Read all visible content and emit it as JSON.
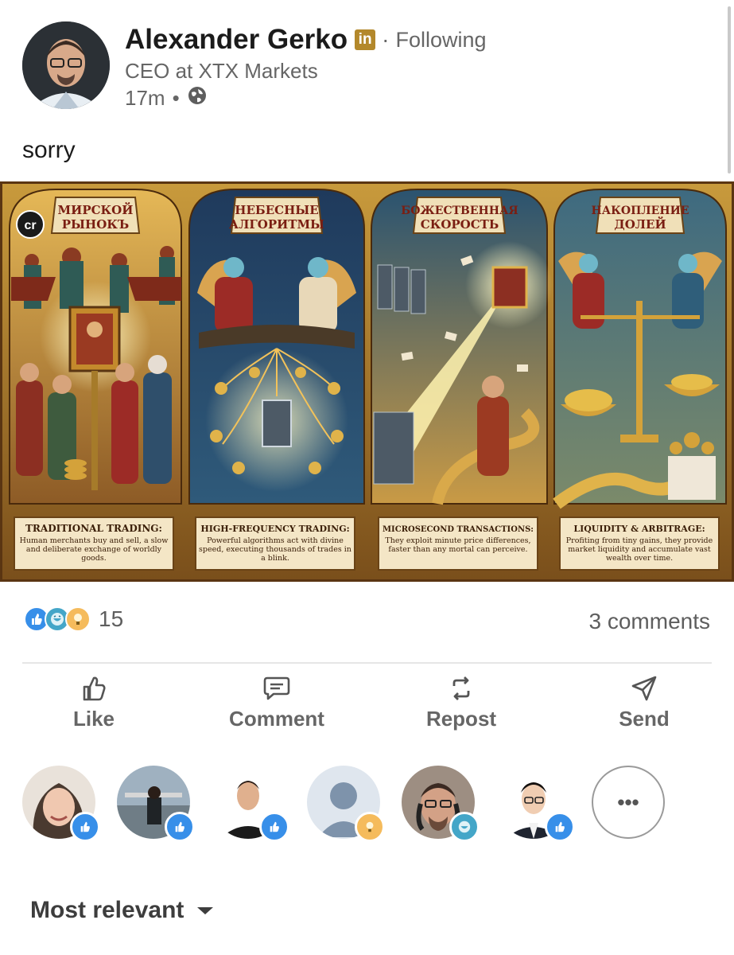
{
  "author": {
    "name": "Alexander Gerko",
    "badge": "in",
    "separator": "·",
    "follow_status": "Following",
    "headline": "CEO at XTX Markets",
    "time": "17m",
    "meta_separator": "•"
  },
  "post": {
    "text": "sorry",
    "image": {
      "logo": "cr",
      "panels": [
        {
          "title_line1": "МИРСКОЙ",
          "title_line2": "РЫНОКЪ",
          "caption_title": "TRADITIONAL TRADING:",
          "caption_text": "Human merchants buy and sell, a slow and deliberate exchange of worldly goods."
        },
        {
          "title_line1": "НЕБЕСНЫЕ",
          "title_line2": "АЛГОРИТМЫ",
          "caption_title": "HIGH-FREQUENCY TRADING:",
          "caption_text": "Powerful algorithms act with divine speed, executing thousands of trades in a blink."
        },
        {
          "title_line1": "БОЖЕСТВЕННАЯ",
          "title_line2": "СКОРОСТЬ",
          "caption_title": "MICROSECOND TRANSACTIONS:",
          "caption_text": "They exploit minute price differences, faster than any mortal can perceive."
        },
        {
          "title_line1": "НАКОПЛЕНИЕ",
          "title_line2": "ДОЛЕЙ",
          "caption_title": "LIQUIDITY & ARBITRAGE:",
          "caption_text": "Profiting from tiny gains, they provide market liquidity and accumulate vast wealth over time."
        }
      ]
    }
  },
  "social": {
    "reaction_count": "15",
    "comments": "3 comments"
  },
  "actions": [
    {
      "label": "Like",
      "icon": "thumbs-up-icon"
    },
    {
      "label": "Comment",
      "icon": "comment-icon"
    },
    {
      "label": "Repost",
      "icon": "repost-icon"
    },
    {
      "label": "Send",
      "icon": "send-icon"
    }
  ],
  "reactors": [
    {
      "reaction": "like"
    },
    {
      "reaction": "like"
    },
    {
      "reaction": "like"
    },
    {
      "reaction": "insightful"
    },
    {
      "reaction": "funny"
    },
    {
      "reaction": "like"
    }
  ],
  "more_label": "•••",
  "sort": {
    "label": "Most relevant"
  },
  "colors": {
    "like": "#378fe9",
    "insightful": "#f5bb5c",
    "funny": "#44a6c8",
    "gold": "#b3882b"
  }
}
